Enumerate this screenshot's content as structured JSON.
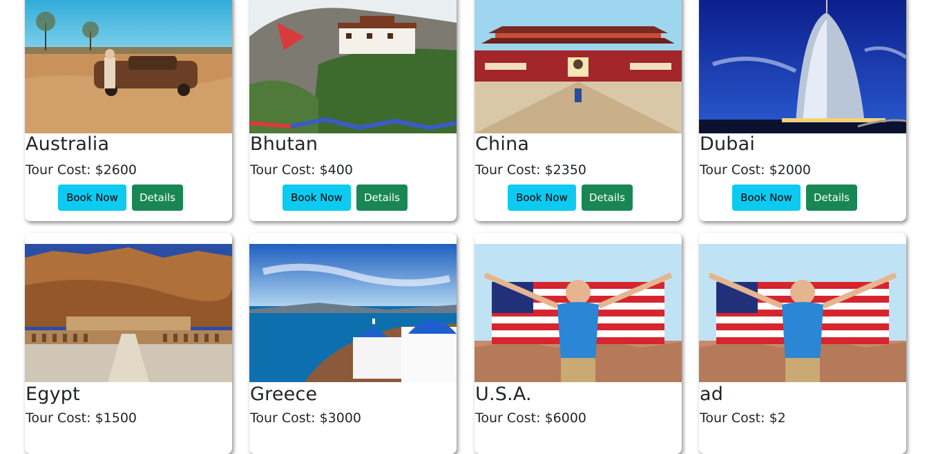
{
  "cost_prefix": "Tour Cost: ",
  "buttons": {
    "book": "Book Now",
    "details": "Details"
  },
  "tours": [
    {
      "title": "Australia",
      "cost": "Tour Cost: $2600"
    },
    {
      "title": "Bhutan",
      "cost": "Tour Cost: $400"
    },
    {
      "title": "China",
      "cost": "Tour Cost: $2350"
    },
    {
      "title": "Dubai",
      "cost": "Tour Cost: $2000"
    },
    {
      "title": "Egypt",
      "cost": "Tour Cost: $1500"
    },
    {
      "title": "Greece",
      "cost": "Tour Cost: $3000"
    },
    {
      "title": "U.S.A.",
      "cost": "Tour Cost: $6000"
    },
    {
      "title": "ad",
      "cost": "Tour Cost: $2"
    }
  ],
  "colors": {
    "book": "#0dcaf0",
    "details": "#198754",
    "text": "#212529"
  }
}
